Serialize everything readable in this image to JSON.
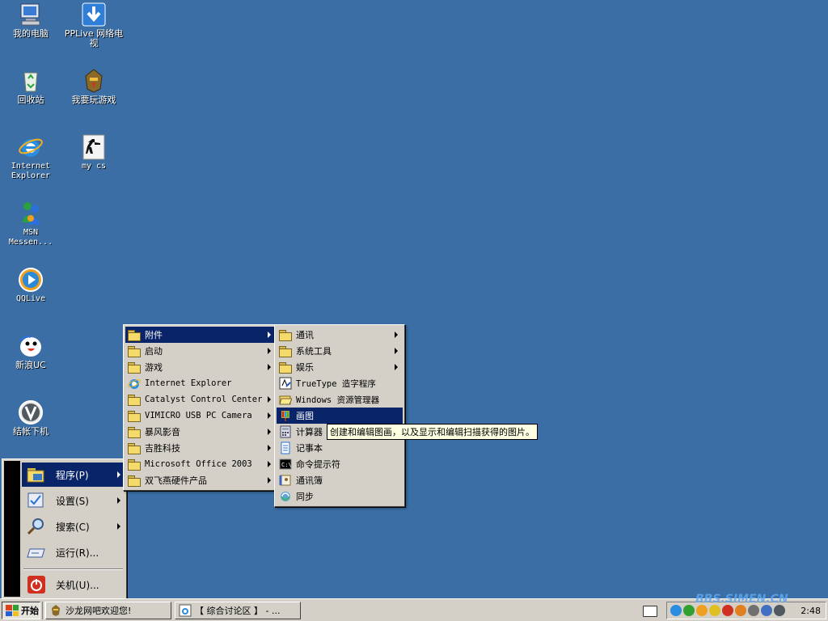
{
  "desktop": {
    "icons": [
      {
        "label": "我的电脑"
      },
      {
        "label": "PPLive 网络电视"
      },
      {
        "label": "回收站"
      },
      {
        "label": "我要玩游戏"
      },
      {
        "label": "Internet Explorer"
      },
      {
        "label": "my cs"
      },
      {
        "label": "MSN Messen..."
      },
      {
        "label": "QQLive"
      },
      {
        "label": "新浪UC"
      },
      {
        "label": "结帐下机"
      }
    ]
  },
  "start_menu": {
    "items": [
      {
        "label": "程序(P)"
      },
      {
        "label": "设置(S)"
      },
      {
        "label": "搜索(C)"
      },
      {
        "label": "运行(R)..."
      },
      {
        "label": "关机(U)..."
      }
    ]
  },
  "programs_menu": {
    "items": [
      {
        "label": "附件"
      },
      {
        "label": "启动"
      },
      {
        "label": "游戏"
      },
      {
        "label": "Internet Explorer"
      },
      {
        "label": "Catalyst Control Center"
      },
      {
        "label": "VIMICRO USB PC Camera"
      },
      {
        "label": "暴风影音"
      },
      {
        "label": "吉胜科技"
      },
      {
        "label": "Microsoft Office 2003"
      },
      {
        "label": "双飞燕硬件产品"
      }
    ]
  },
  "accessories_menu": {
    "items": [
      {
        "label": "通讯"
      },
      {
        "label": "系统工具"
      },
      {
        "label": "娱乐"
      },
      {
        "label": "TrueType 造字程序"
      },
      {
        "label": "Windows 资源管理器"
      },
      {
        "label": "画图"
      },
      {
        "label": "计算器"
      },
      {
        "label": "记事本"
      },
      {
        "label": "命令提示符"
      },
      {
        "label": "通讯簿"
      },
      {
        "label": "同步"
      }
    ]
  },
  "tooltip": {
    "text": "创建和编辑图画，以及显示和编辑扫描获得的图片。"
  },
  "taskbar": {
    "start_label": "开始",
    "tasks": [
      {
        "label": "沙龙网吧欢迎您!"
      },
      {
        "label": "【 综合讨论区 】 - ..."
      }
    ],
    "clock": "2:48"
  },
  "watermark": {
    "text": "BBS.SIMEN.CN"
  },
  "colors": {
    "desktop": "#3a6ea5",
    "highlight": "#0a246a",
    "face": "#d4d0c8"
  }
}
